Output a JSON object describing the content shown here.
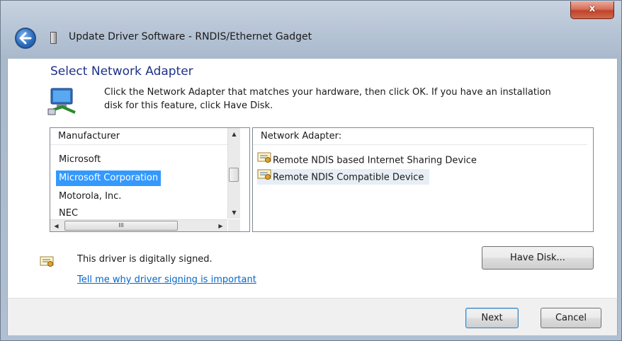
{
  "window": {
    "title": "Update Driver Software - RNDIS/Ethernet Gadget",
    "close_glyph": "x"
  },
  "page": {
    "heading": "Select Network Adapter",
    "instructions": "Click the Network Adapter that matches your hardware, then click OK. If you have an installation disk for this feature, click Have Disk."
  },
  "manufacturer_list": {
    "header": "Manufacturer",
    "items": [
      "Microsoft",
      "Microsoft Corporation",
      "Motorola, Inc.",
      "NEC"
    ],
    "selected": "Microsoft Corporation"
  },
  "adapter_list": {
    "header": "Network Adapter:",
    "items": [
      "Remote NDIS based Internet Sharing Device",
      "Remote NDIS Compatible Device"
    ],
    "highlighted": "Remote NDIS Compatible Device"
  },
  "signing": {
    "status": "This driver is digitally signed.",
    "link": "Tell me why driver signing is important"
  },
  "buttons": {
    "have_disk": "Have Disk...",
    "next": "Next",
    "cancel": "Cancel"
  },
  "scrollbar_glyphs": {
    "up": "▲",
    "down": "▼",
    "left": "◀",
    "right": "▶",
    "grip": "III"
  },
  "colors": {
    "accent_selection": "#3399ff",
    "heading": "#1e3287",
    "link": "#0066cc"
  }
}
